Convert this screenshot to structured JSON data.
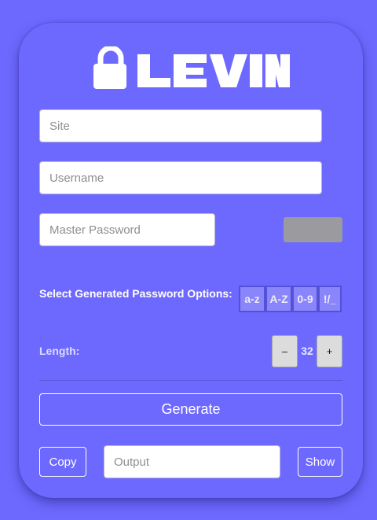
{
  "brand": {
    "name": "LEVIN",
    "icon": "lock-icon"
  },
  "form": {
    "site_placeholder": "Site",
    "username_placeholder": "Username",
    "master_placeholder": "Master Password",
    "output_placeholder": "Output"
  },
  "options": {
    "label": "Select Generated Password Options:",
    "items": [
      "a-z",
      "A-Z",
      "0-9",
      "!/_"
    ]
  },
  "length": {
    "label": "Length:",
    "value": "32",
    "minus": "–",
    "plus": "+"
  },
  "actions": {
    "generate": "Generate",
    "copy": "Copy",
    "show": "Show"
  },
  "colors": {
    "background": "#6e69fe",
    "option_button": "#8985fb",
    "strength_meter": "#9b9a9f"
  }
}
